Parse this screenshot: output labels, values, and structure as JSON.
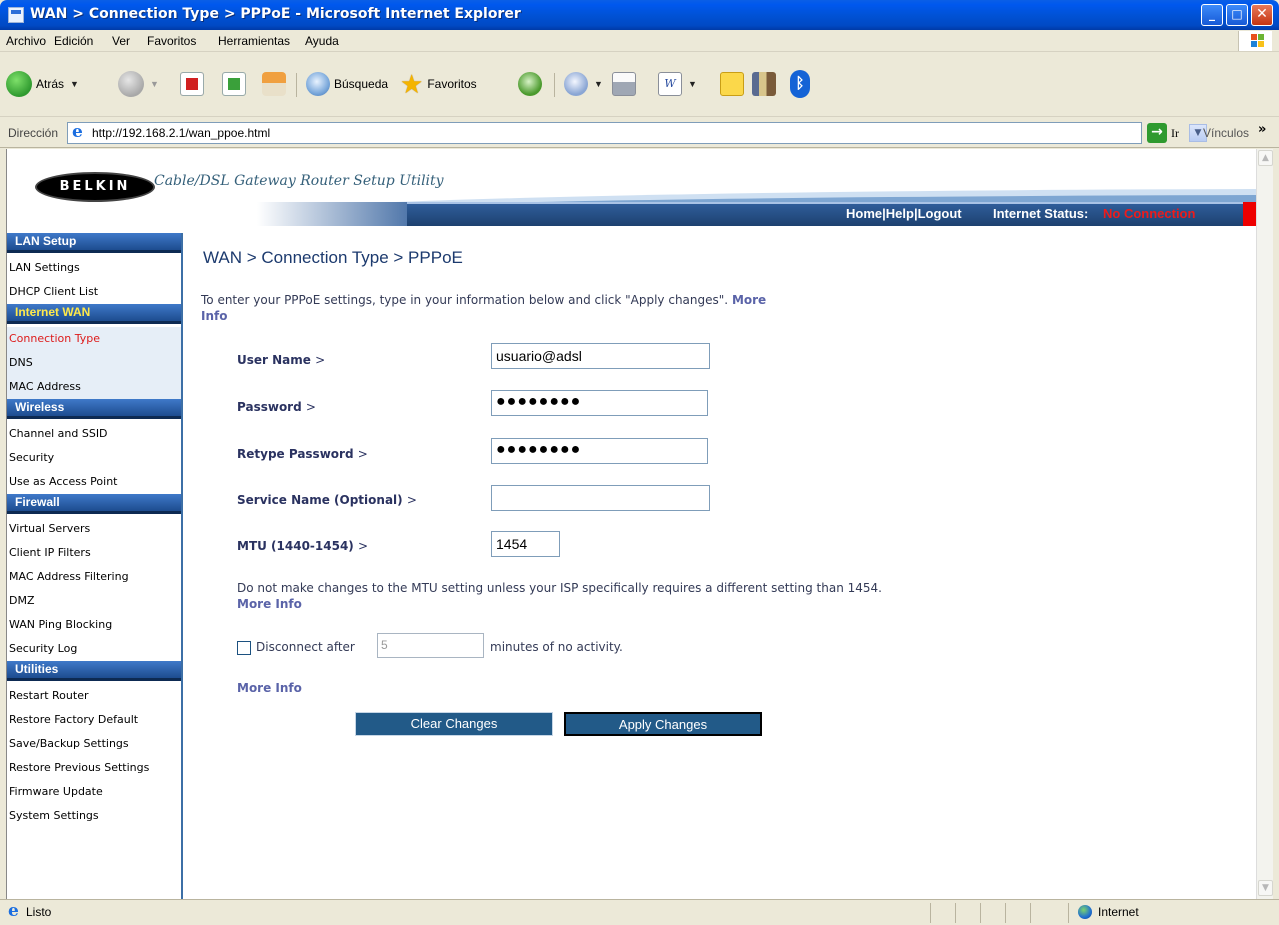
{
  "window": {
    "title": "WAN > Connection Type > PPPoE - Microsoft Internet Explorer",
    "controls": {
      "minimize": "_",
      "maximize": "□",
      "close": "✕"
    }
  },
  "menu": [
    "Archivo",
    "Edición",
    "Ver",
    "Favoritos",
    "Herramientas",
    "Ayuda"
  ],
  "toolbar": {
    "back": "Atrás",
    "search": "Búsqueda",
    "favorites": "Favoritos"
  },
  "address": {
    "label": "Dirección",
    "url": "http://192.168.2.1/wan_ppoe.html",
    "go": "Ir",
    "links": "Vínculos",
    "links_chevron": "»"
  },
  "header": {
    "logo": "BELKIN",
    "utility_title": "Cable/DSL Gateway Router Setup Utility",
    "links": [
      "Home",
      "Help",
      "Logout"
    ],
    "status_label": "Internet Status:",
    "status_value": "No Connection",
    "colors": {
      "bar": "#2f5d9a",
      "status": "#ee1b1b"
    }
  },
  "sidebar": {
    "lan_setup": {
      "title": "LAN Setup",
      "items": [
        "LAN Settings",
        "DHCP Client List"
      ]
    },
    "internet_wan": {
      "title": "Internet WAN",
      "items": [
        "Connection Type",
        "DNS",
        "MAC Address"
      ],
      "selected": "Connection Type"
    },
    "wireless": {
      "title": "Wireless",
      "items": [
        "Channel and SSID",
        "Security",
        "Use as Access Point"
      ]
    },
    "firewall": {
      "title": "Firewall",
      "items": [
        "Virtual Servers",
        "Client IP Filters",
        "MAC Address Filtering",
        "DMZ",
        "WAN Ping Blocking",
        "Security Log"
      ]
    },
    "utilities": {
      "title": "Utilities",
      "items": [
        "Restart Router",
        "Restore Factory Default",
        "Save/Backup Settings",
        "Restore Previous Settings",
        "Firmware Update",
        "System Settings"
      ]
    }
  },
  "main": {
    "title": "WAN > Connection Type > PPPoE",
    "intro": "To enter your PPPoE settings, type in your information below and click \"Apply changes\".",
    "more_info": "More Info",
    "more_info_word1": "More",
    "more_info_word2": "Info",
    "gt": ">",
    "fields": {
      "username": {
        "label": "User Name",
        "value": "usuario@adsl"
      },
      "password": {
        "label": "Password",
        "value": "●●●●●●●●"
      },
      "retype": {
        "label": "Retype Password",
        "value": "●●●●●●●●"
      },
      "service": {
        "label": "Service Name (Optional)",
        "value": ""
      },
      "mtu": {
        "label": "MTU (1440-1454)",
        "value": "1454"
      }
    },
    "mtu_note": "Do not make changes to the MTU setting unless your ISP specifically requires a different setting than 1454.",
    "disconnect": {
      "label": "Disconnect after",
      "value": "5",
      "suffix": "minutes of no activity.",
      "checked": false
    },
    "buttons": {
      "clear": "Clear Changes",
      "apply": "Apply Changes"
    }
  },
  "statusbar": {
    "text": "Listo",
    "zone": "Internet"
  }
}
